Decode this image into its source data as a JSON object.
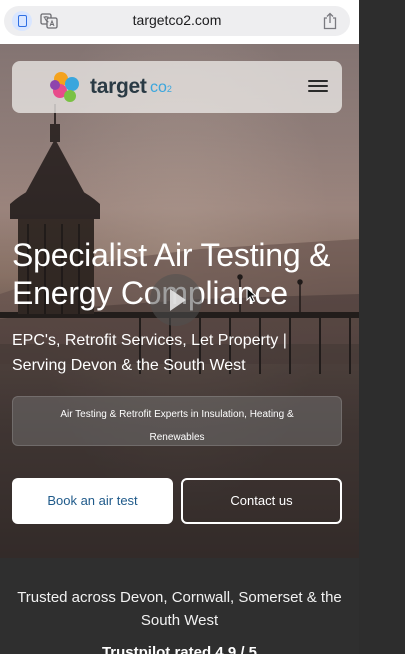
{
  "browser": {
    "url": "targetco2.com",
    "icons": {
      "reader": "reader-icon",
      "translate": "translate-icon",
      "share": "share-icon"
    }
  },
  "nav": {
    "logo_text": "target",
    "logo_co": "co",
    "logo_sub": "2",
    "menu_icon": "hamburger-menu-icon"
  },
  "hero": {
    "headline": "Specialist Air Testing & Energy Compliance",
    "subheading": "EPC's, Retrofit Services, Let Property | Serving Devon & the South West",
    "tagline": "Air Testing & Retrofit Experts in Insulation, Heating & Renewables",
    "play_icon": "play-icon",
    "buttons": {
      "book": "Book an air test",
      "contact": "Contact us"
    }
  },
  "trust": {
    "text": "Trusted across Devon, Cornwall, Somerset & the South West",
    "rating": "Trustpilot rated 4.9 / 5"
  },
  "colors": {
    "accent_blue": "#1f5a8a",
    "logo_blue": "#3aa6dd",
    "dark_bg": "#2f2f2f"
  }
}
